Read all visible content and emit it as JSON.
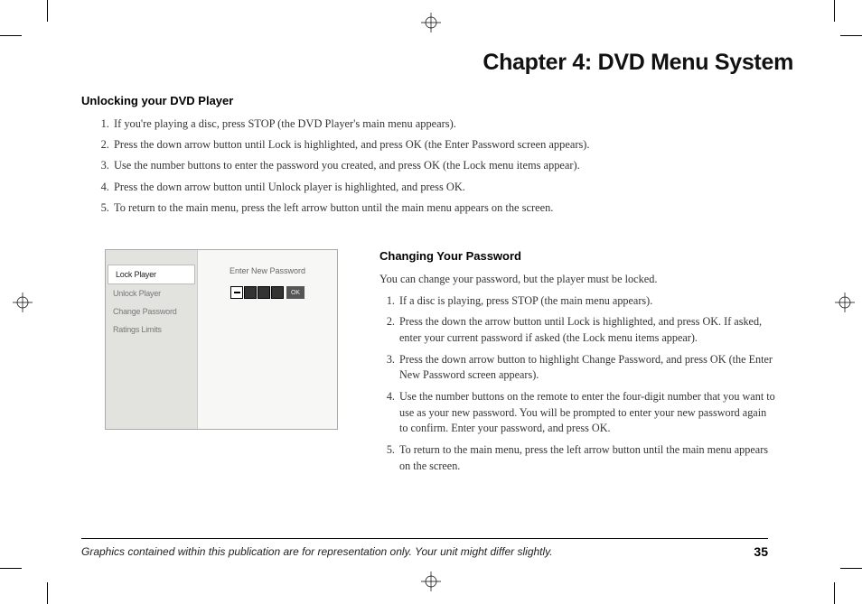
{
  "chapter_title": "Chapter 4: DVD Menu System",
  "section1": {
    "heading": "Unlocking your DVD Player",
    "items": [
      "If you're playing a disc, press STOP (the DVD Player's main menu appears).",
      "Press the down arrow button until Lock is highlighted, and press OK (the Enter Password screen appears).",
      "Use the number buttons to enter the password you created, and press OK (the Lock menu items appear).",
      "Press the down arrow button until Unlock player is highlighted, and press OK.",
      "To return to the main menu, press the left arrow button until the main menu appears on the screen."
    ]
  },
  "menu": {
    "items": [
      "Lock Player",
      "Unlock Player",
      "Change Password",
      "Ratings Limits"
    ],
    "panel_label": "Enter New Password",
    "ok_label": "OK"
  },
  "section2": {
    "heading": "Changing Your Password",
    "intro": "You can change your password, but the player must be locked.",
    "items": [
      "If a disc is playing, press STOP (the main menu appears).",
      "Press the down the arrow button until Lock is highlighted, and press OK. If asked, enter your current password if asked (the Lock menu items appear).",
      "Press the down arrow button to highlight Change Password, and press OK (the Enter New Password screen appears).",
      "Use the number buttons on the remote to enter the four-digit number that you want to use as your new password. You will be prompted to enter your new password again to confirm. Enter your password, and press OK.",
      "To return to the main menu, press the left arrow button until the main menu appears on the screen."
    ]
  },
  "footer": {
    "disclaimer": "Graphics contained within this publication are for representation only. Your unit might differ slightly.",
    "page_number": "35"
  }
}
